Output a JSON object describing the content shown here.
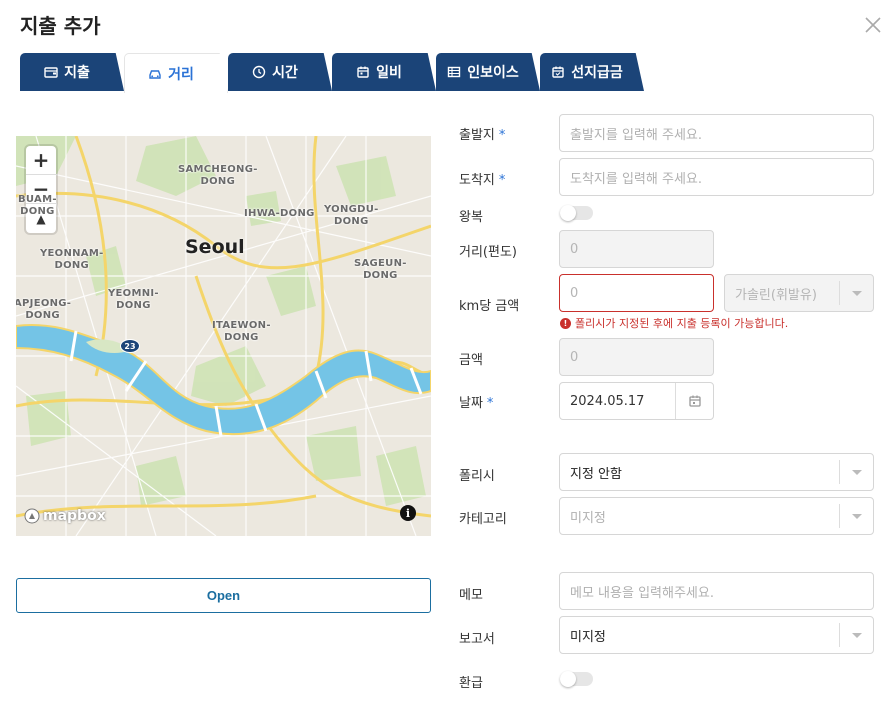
{
  "dialog": {
    "title": "지출 추가"
  },
  "tabs": [
    {
      "label": "지출",
      "icon": "wallet-icon"
    },
    {
      "label": "거리",
      "icon": "car-icon",
      "active": true
    },
    {
      "label": "시간",
      "icon": "clock-icon"
    },
    {
      "label": "일비",
      "icon": "calendar-icon"
    },
    {
      "label": "인보이스",
      "icon": "invoice-icon"
    },
    {
      "label": "선지급금",
      "icon": "calendar-check-icon"
    }
  ],
  "map": {
    "city": "Seoul",
    "labels": {
      "samcheong": "SAMCHEONG-\nDONG",
      "ihwa": "IHWA-DONG",
      "yongdu": "YONGDU-\nDONG",
      "buwa": "BUAM-\nDONG",
      "yeonnam": "YEONNAM-\nDONG",
      "sageun": "SAGEUN-\nDONG",
      "apjeong": "APJEONG-\nDONG",
      "yeomni": "YEOMNI-\nDONG",
      "itaewon": "ITAEWON-\nDONG"
    },
    "route_shield": "23",
    "zoom_in": "+",
    "zoom_out": "−",
    "compass": "▲",
    "brand": "mapbox",
    "info": "i"
  },
  "open_button": "Open",
  "form": {
    "origin": {
      "label": "출발지",
      "placeholder": "출발지를 입력해 주세요."
    },
    "destination": {
      "label": "도착지",
      "placeholder": "도착지를 입력해 주세요."
    },
    "round_trip": {
      "label": "왕복"
    },
    "distance": {
      "label": "거리(편도)",
      "value": "0"
    },
    "rate": {
      "label": "km당 금액",
      "value": "0",
      "fuel": "가솔린(휘발유)",
      "error": "폴리시가 지정된 후에 지출 등록이 가능합니다."
    },
    "amount": {
      "label": "금액",
      "value": "0"
    },
    "date": {
      "label": "날짜",
      "value": "2024.05.17"
    },
    "policy": {
      "label": "폴리시",
      "value": "지정 안함"
    },
    "category": {
      "label": "카테고리",
      "value": "미지정"
    },
    "memo": {
      "label": "메모",
      "placeholder": "메모 내용을 입력해주세요."
    },
    "report": {
      "label": "보고서",
      "value": "미지정"
    },
    "refund": {
      "label": "환급"
    },
    "required_mark": "*"
  },
  "colors": {
    "tab_bg": "#1b4478",
    "accent": "#2a72d6",
    "error": "#c9302c",
    "river": "#6dc5e6"
  }
}
